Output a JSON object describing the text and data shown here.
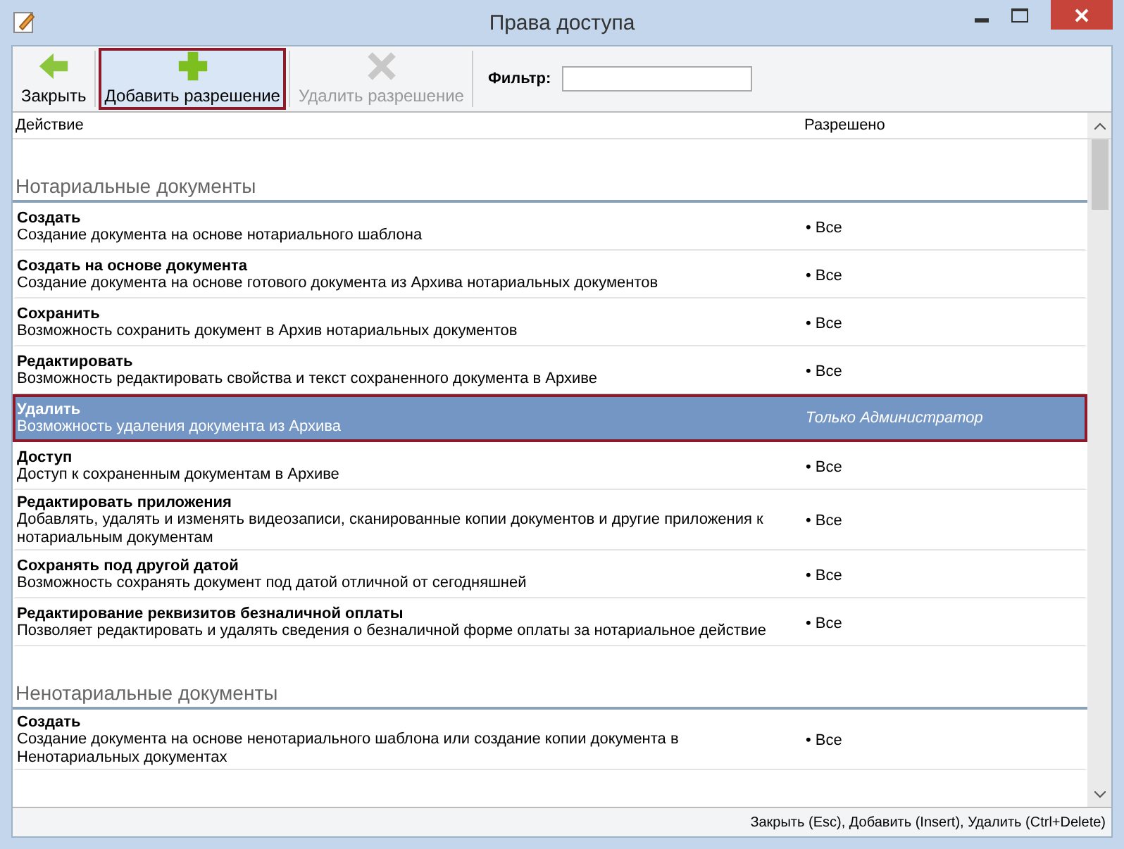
{
  "window": {
    "title": "Права доступа"
  },
  "toolbar": {
    "buttons": [
      {
        "label": "Закрыть",
        "kind": "back",
        "disabled": false,
        "focused": false
      },
      {
        "label": "Добавить разрешение",
        "kind": "add",
        "disabled": false,
        "focused": true
      },
      {
        "label": "Удалить разрешение",
        "kind": "delete",
        "disabled": true,
        "focused": false
      }
    ],
    "filter": {
      "label": "Фильтр:"
    }
  },
  "table": {
    "columns": [
      "Действие",
      "Разрешено"
    ],
    "groups": [
      {
        "title": "Нотариальные документы",
        "rows": [
          {
            "title": "Создать",
            "description": "Создание документа на основе нотариального шаблона",
            "allowed": "• Все",
            "selected": false
          },
          {
            "title": "Создать на основе документа",
            "description": "Создание документа на основе готового документа из Архива нотариальных документов",
            "allowed": "• Все",
            "selected": false
          },
          {
            "title": "Сохранить",
            "description": "Возможность сохранить документ в Архив нотариальных документов",
            "allowed": "• Все",
            "selected": false
          },
          {
            "title": "Редактировать",
            "description": "Возможность редактировать свойства и текст сохраненного документа в Архиве",
            "allowed": "• Все",
            "selected": false
          },
          {
            "title": "Удалить",
            "description": "Возможность удаления документа из Архива",
            "allowed": "Только Администратор",
            "selected": true
          },
          {
            "title": "Доступ",
            "description": "Доступ к сохраненным документам в Архиве",
            "allowed": "• Все",
            "selected": false
          },
          {
            "title": "Редактировать приложения",
            "description": "Добавлять, удалять и изменять видеозаписи, сканированные копии документов и другие приложения к нотариальным документам",
            "allowed": "• Все",
            "selected": false
          },
          {
            "title": "Сохранять под другой датой",
            "description": "Возможность сохранять документ под датой отличной от сегодняшней",
            "allowed": "• Все",
            "selected": false
          },
          {
            "title": "Редактирование реквизитов безналичной оплаты",
            "description": "Позволяет редактировать и удалять сведения о безналичной форме оплаты за нотариальное действие",
            "allowed": "• Все",
            "selected": false
          }
        ]
      },
      {
        "title": "Ненотариальные документы",
        "rows": [
          {
            "title": "Создать",
            "description": "Создание документа на основе ненотариального шаблона или создание копии документа в Ненотариальных документах",
            "allowed": "• Все",
            "selected": false
          }
        ]
      }
    ]
  },
  "status_bar": "Закрыть (Esc), Добавить (Insert), Удалить (Ctrl+Delete)"
}
